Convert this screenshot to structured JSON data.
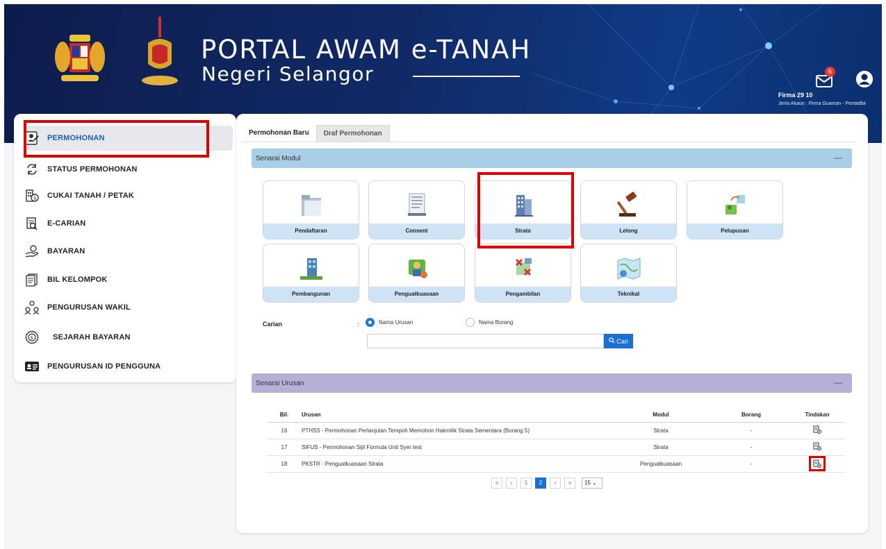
{
  "header": {
    "title": "PORTAL AWAM e-TANAH",
    "subtitle": "Negeri Selangor",
    "notification_count": "6",
    "firm_name": "Firma 29 10",
    "account_type": "Jenis Akaun : Firma Guaman - Pentadbir"
  },
  "sidebar": {
    "items": [
      {
        "label": "PERMOHONAN",
        "icon": "application-form-icon"
      },
      {
        "label": "STATUS PERMOHONAN",
        "icon": "refresh-icon"
      },
      {
        "label": "CUKAI TANAH / PETAK",
        "icon": "tax-building-icon"
      },
      {
        "label": "E-CARIAN",
        "icon": "search-document-icon"
      },
      {
        "label": "BAYARAN",
        "icon": "payment-hand-icon"
      },
      {
        "label": "BIL KELOMPOK",
        "icon": "bill-batch-icon"
      },
      {
        "label": "PENGURUSAN WAKIL",
        "icon": "agents-icon"
      },
      {
        "label": "SEJARAH BAYARAN",
        "icon": "payment-history-icon"
      },
      {
        "label": "PENGURUSAN ID PENGGUNA",
        "icon": "id-card-icon"
      }
    ]
  },
  "tabs": [
    "Permohonan Baru",
    "Draf Permohonan"
  ],
  "modul": {
    "heading": "Senarai Modul",
    "cards": [
      {
        "label": "Pendaftaran",
        "icon": "folder-icon"
      },
      {
        "label": "Consent",
        "icon": "document-icon"
      },
      {
        "label": "Strata",
        "icon": "building-icon"
      },
      {
        "label": "Lelong",
        "icon": "gavel-icon"
      },
      {
        "label": "Pelupusan",
        "icon": "land-disposal-icon"
      },
      {
        "label": "Pembangunan",
        "icon": "development-icon"
      },
      {
        "label": "Penguatkuasaan",
        "icon": "enforcement-icon"
      },
      {
        "label": "Pengambilan",
        "icon": "acquisition-icon"
      },
      {
        "label": "Teknikal",
        "icon": "map-icon"
      }
    ]
  },
  "search": {
    "label": "Carian",
    "colon": ":",
    "option_1": "Nama Urusan",
    "option_2": "Nama Borang",
    "selected": "Nama Urusan",
    "value": "",
    "placeholder": "",
    "button": "Cari"
  },
  "urusan": {
    "heading": "Senarai Urusan",
    "columns": [
      "Bil.",
      "Urusan",
      "Modul",
      "Borang",
      "Tindakan"
    ],
    "rows": [
      {
        "bil": "16",
        "urusan": "PTHSS - Permohonan Perlanjutan Tempoh Memohon Hakmilik Strata Sementara (Borang 5)",
        "modul": "Strata",
        "borang": "-"
      },
      {
        "bil": "17",
        "urusan": "SIFUS - Permohonan Sijil Formula Unit Syer test",
        "modul": "Strata",
        "borang": "-"
      },
      {
        "bil": "18",
        "urusan": "PKSTR - Penguatkuasaan Strata",
        "modul": "Penguatkuasaan",
        "borang": "-"
      }
    ]
  },
  "pagination": {
    "first": "«",
    "prev": "‹",
    "pages": [
      "1",
      "2"
    ],
    "current": "2",
    "next": "›",
    "last": "»",
    "page_size": "15"
  },
  "colors": {
    "accent": "#1a6fd1",
    "highlight": "#e10000",
    "modul_header": "#a9cfe8",
    "urusan_header": "#b6b0d6"
  }
}
